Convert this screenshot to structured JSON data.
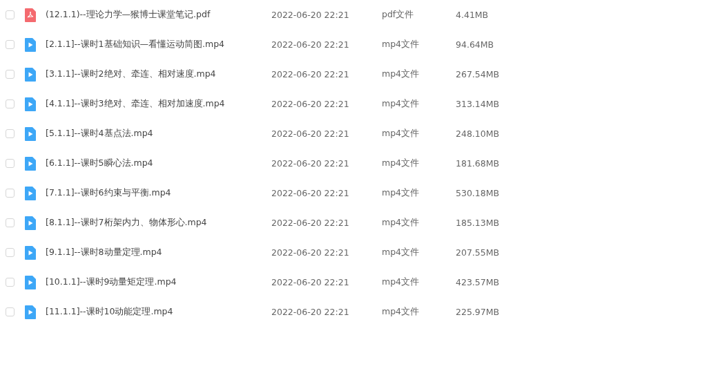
{
  "files": [
    {
      "kind": "pdf",
      "checked": false,
      "name": "(12.1.1)--理论力学—猴博士课堂笔记.pdf",
      "modified": "2022-06-20 22:21",
      "type": "pdf文件",
      "size": "4.41MB"
    },
    {
      "kind": "video",
      "checked": false,
      "name": "[2.1.1]--课时1基础知识—看懂运动简图.mp4",
      "modified": "2022-06-20 22:21",
      "type": "mp4文件",
      "size": "94.64MB"
    },
    {
      "kind": "video",
      "checked": false,
      "name": "[3.1.1]--课时2绝对、牵连、相对速度.mp4",
      "modified": "2022-06-20 22:21",
      "type": "mp4文件",
      "size": "267.54MB"
    },
    {
      "kind": "video",
      "checked": false,
      "name": "[4.1.1]--课时3绝对、牵连、相对加速度.mp4",
      "modified": "2022-06-20 22:21",
      "type": "mp4文件",
      "size": "313.14MB"
    },
    {
      "kind": "video",
      "checked": false,
      "name": "[5.1.1]--课时4基点法.mp4",
      "modified": "2022-06-20 22:21",
      "type": "mp4文件",
      "size": "248.10MB"
    },
    {
      "kind": "video",
      "checked": false,
      "name": "[6.1.1]--课时5瞬心法.mp4",
      "modified": "2022-06-20 22:21",
      "type": "mp4文件",
      "size": "181.68MB"
    },
    {
      "kind": "video",
      "checked": false,
      "name": "[7.1.1]--课时6约束与平衡.mp4",
      "modified": "2022-06-20 22:21",
      "type": "mp4文件",
      "size": "530.18MB"
    },
    {
      "kind": "video",
      "checked": false,
      "name": "[8.1.1]--课时7桁架内力、物体形心.mp4",
      "modified": "2022-06-20 22:21",
      "type": "mp4文件",
      "size": "185.13MB"
    },
    {
      "kind": "video",
      "checked": false,
      "name": "[9.1.1]--课时8动量定理.mp4",
      "modified": "2022-06-20 22:21",
      "type": "mp4文件",
      "size": "207.55MB"
    },
    {
      "kind": "video",
      "checked": false,
      "name": "[10.1.1]--课时9动量矩定理.mp4",
      "modified": "2022-06-20 22:21",
      "type": "mp4文件",
      "size": "423.57MB"
    },
    {
      "kind": "video",
      "checked": false,
      "name": "[11.1.1]--课时10动能定理.mp4",
      "modified": "2022-06-20 22:21",
      "type": "mp4文件",
      "size": "225.97MB"
    }
  ]
}
